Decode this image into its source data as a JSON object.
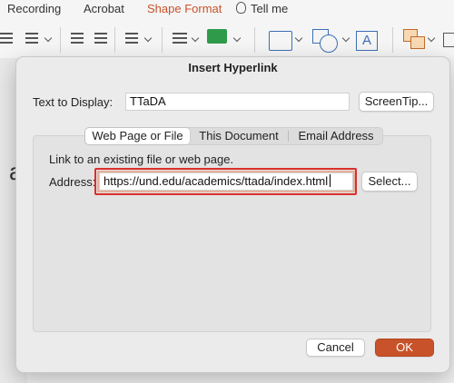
{
  "ribbon": {
    "tabs": [
      "Recording",
      "Acrobat",
      "Shape Format",
      "Tell me"
    ],
    "active_tab": "Shape Format",
    "accent_color": "#c8522a"
  },
  "dialog": {
    "title": "Insert Hyperlink",
    "text_to_display_label": "Text to Display:",
    "text_to_display_value": "TTaDA",
    "screentip_button": "ScreenTip...",
    "tabs": {
      "web": "Web Page or File",
      "document": "This Document",
      "email": "Email Address"
    },
    "active_tab": "Web Page or File",
    "link_hint": "Link to an existing file or web page.",
    "address_label": "Address:",
    "address_value": "https://und.edu/academics/ttada/index.html",
    "select_button": "Select...",
    "cancel_button": "Cancel",
    "ok_button": "OK",
    "highlight_color": "#d9302c"
  },
  "background": {
    "slide_letter": "a"
  }
}
